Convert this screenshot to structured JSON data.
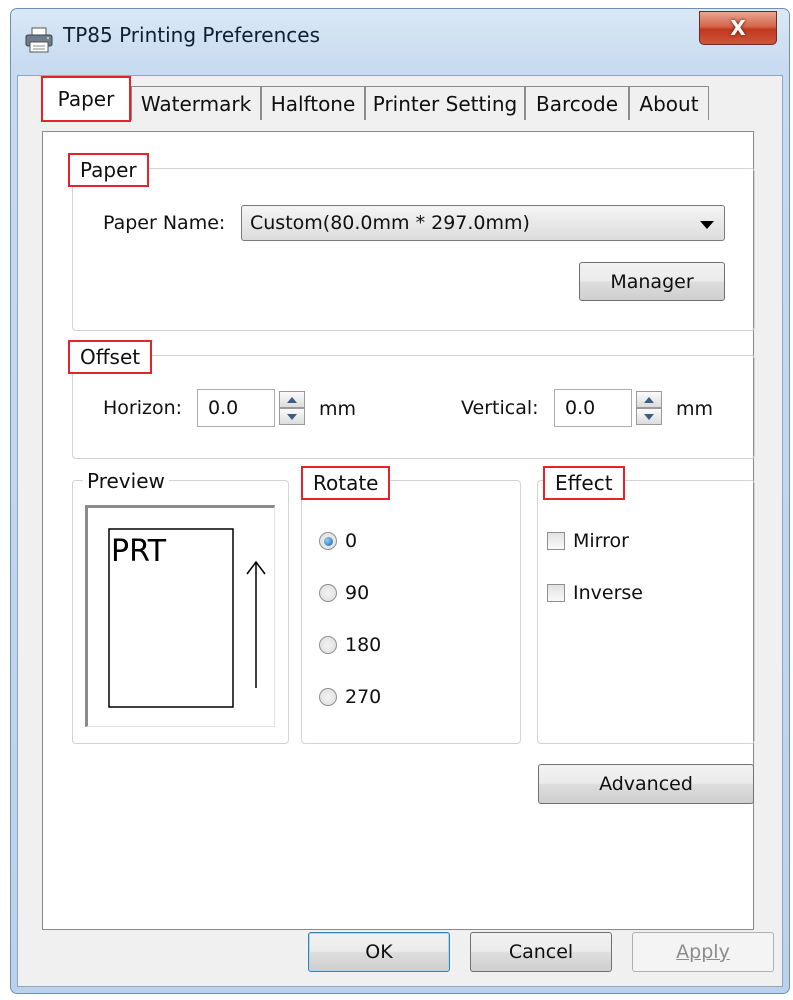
{
  "window": {
    "title": "TP85 Printing Preferences",
    "close_label": "X"
  },
  "tabs": [
    {
      "label": "Paper",
      "selected": true
    },
    {
      "label": "Watermark"
    },
    {
      "label": "Halftone"
    },
    {
      "label": "Printer Setting"
    },
    {
      "label": "Barcode"
    },
    {
      "label": "About"
    }
  ],
  "paper_group": {
    "legend": "Paper",
    "paper_name_label": "Paper Name:",
    "paper_name_value": "Custom(80.0mm * 297.0mm)",
    "manager_label": "Manager"
  },
  "offset_group": {
    "legend": "Offset",
    "horizon_label": "Horizon:",
    "horizon_value": "0.0",
    "horizon_unit": "mm",
    "vertical_label": "Vertical:",
    "vertical_value": "0.0",
    "vertical_unit": "mm"
  },
  "preview_group": {
    "legend": "Preview",
    "sample_text": "PRT"
  },
  "rotate_group": {
    "legend": "Rotate",
    "options": [
      "0",
      "90",
      "180",
      "270"
    ],
    "selected": "0"
  },
  "effect_group": {
    "legend": "Effect",
    "mirror_label": "Mirror",
    "inverse_label": "Inverse"
  },
  "advanced_label": "Advanced",
  "dialog_buttons": {
    "ok": "OK",
    "cancel": "Cancel",
    "apply": "Apply"
  },
  "colors": {
    "highlight_border": "#e3242b",
    "close_button": "#c7432a"
  },
  "icons": {
    "window": "printer-icon",
    "close": "close-icon"
  }
}
